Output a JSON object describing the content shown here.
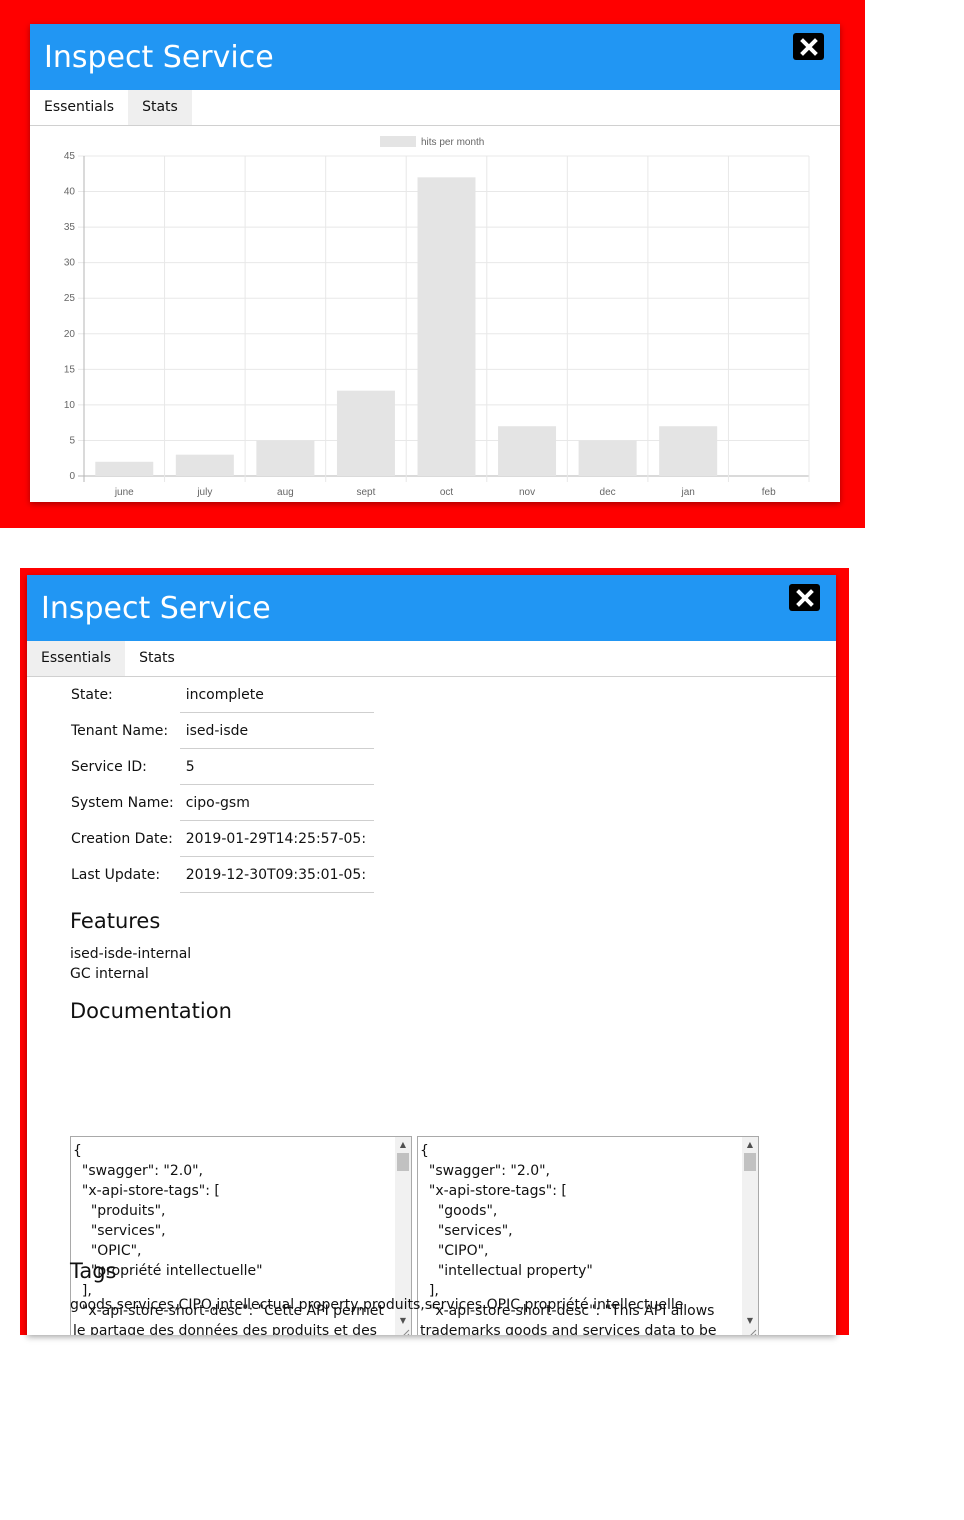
{
  "colors": {
    "frame": "#ff0000",
    "header": "#2196f3",
    "bar": "#e4e4e4"
  },
  "dialog_stats": {
    "title": "Inspect Service",
    "tabs": [
      {
        "label": "Essentials"
      },
      {
        "label": "Stats"
      }
    ],
    "active_tab": "Stats"
  },
  "chart_data": {
    "type": "bar",
    "categories": [
      "june",
      "july",
      "aug",
      "sept",
      "oct",
      "nov",
      "dec",
      "jan",
      "feb"
    ],
    "series": [
      {
        "name": "hits per month",
        "values": [
          2,
          3,
          5,
          12,
          42,
          7,
          5,
          7,
          0
        ]
      }
    ],
    "ylim": [
      0,
      45
    ],
    "yticks": [
      0,
      5,
      10,
      15,
      20,
      25,
      30,
      35,
      40,
      45
    ],
    "grid": true,
    "legend": "top-center"
  },
  "dialog_essentials": {
    "title": "Inspect Service",
    "tabs": [
      {
        "label": "Essentials"
      },
      {
        "label": "Stats"
      }
    ],
    "active_tab": "Essentials",
    "fields": [
      {
        "label": "State:",
        "value": "incomplete"
      },
      {
        "label": "Tenant Name:",
        "value": "ised-isde"
      },
      {
        "label": "Service ID:",
        "value": "5"
      },
      {
        "label": "System Name:",
        "value": "cipo-gsm"
      },
      {
        "label": "Creation Date:",
        "value": "2019-01-29T14:25:57-05:"
      },
      {
        "label": "Last Update:",
        "value": "2019-12-30T09:35:01-05:"
      }
    ],
    "features_heading": "Features",
    "features": [
      "ised-isde-internal",
      "GC internal"
    ],
    "documentation_heading": "Documentation",
    "doc_fr": "{\n  \"swagger\": \"2.0\",\n  \"x-api-store-tags\": [\n    \"produits\",\n    \"services\",\n    \"OPIC\",\n    \"propriété intellectuelle\"\n  ],\n  \"x-api-store-short-desc\": \"Cette API permet le partage des données des produits et des",
    "doc_en": "{\n  \"swagger\": \"2.0\",\n  \"x-api-store-tags\": [\n    \"goods\",\n    \"services\",\n    \"CIPO\",\n    \"intellectual property\"\n  ],\n  \"x-api-store-short-desc\": \"This API allows trademarks goods and services data to be",
    "tags_heading": "Tags",
    "tags": "goods,services,CIPO,intellectual property,produits,services,OPIC,propriété intellectuelle"
  }
}
